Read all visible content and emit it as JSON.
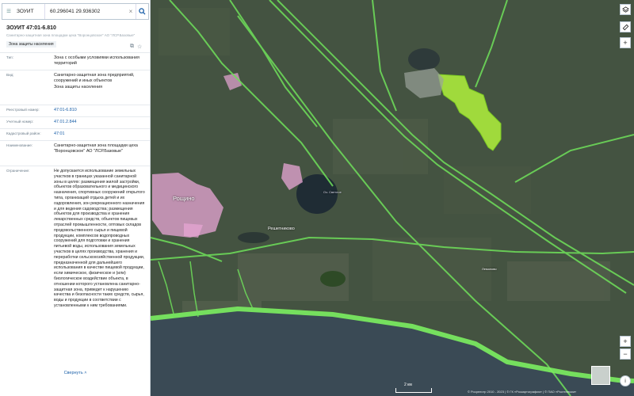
{
  "search": {
    "layer": "ЗОУИТ",
    "coords": "60.296041 29.936302"
  },
  "card": {
    "title": "ЗОУИТ 47:01-6.810",
    "subtitle": "Санитарно-защитная зона площадки цеха \"Воронцовское\" АО \"ЛСР.Базовые\"",
    "tag": "Зона защиты населения",
    "rows": {
      "type": {
        "key": "Тип:",
        "value": "Зона с особыми условиями использования территорий"
      },
      "kind": {
        "key": "Вид:",
        "value": "Санитарно-защитная зона предприятий, сооружений и иных объектов",
        "value2": "Зона защиты населения"
      },
      "reg": {
        "key": "Реестровый номер:",
        "value": "47:01-6.810"
      },
      "acc": {
        "key": "Учетный номер:",
        "value": "47.01.2.844"
      },
      "dist": {
        "key": "Кадастровый район:",
        "value": "47:01"
      },
      "name": {
        "key": "Наименование:",
        "value": "Санитарно-защитная зона площадки цеха \"Воронцовское\" АО \"ЛСР.Базовые\""
      },
      "desc": {
        "key": "Ограничение:",
        "value": "Не допускается использование земельных участков в границах указанной санитарной зоны в целях: размещения жилой застройки, объектов образовательного и медицинского назначения, спортивных сооружений открытого типа, организаций отдыха детей и их оздоровления, зон рекреационного назначения и для ведения садоводства; размещения объектов для производства и хранения лекарственных средств, объектов пищевых отраслей промышленности, оптовых складов продовольственного сырья и пищевой продукции, комплексов водопроводных сооружений для подготовки и хранения питьевой воды, использования земельных участков в целях производства, хранения и переработки сельскохозяйственной продукции, предназначенной для дальнейшего использования в качестве пищевой продукции, если химическое, физическое и (или) биологическое воздействие объекта, в отношении которого установлена санитарно-защитная зона, приведет к нарушению качества и безопасности таких средств, сырья, воды и продукции в соответствии с установленными к ним требованиями."
      }
    },
    "collapse_label": "Свернуть"
  },
  "map": {
    "places": {
      "roshchino": "Рощино",
      "reshetnikovo": "Решетниково",
      "lake": "Оз. Светлое",
      "lemmiki": "Лемолово"
    },
    "scale_label": "2 км",
    "attribution": "© Росреестр 2010 - 2023 | © ГК «Роскартография» | © ПАО «Ростелеком»",
    "colors": {
      "zone_fill": "#a8e63c",
      "zone_border": "#7ed320",
      "road_line": "#6fe05a",
      "residential": "#e8a6d6"
    }
  },
  "controls": {
    "zoom_in": "+",
    "zoom_out": "−",
    "add": "+"
  }
}
